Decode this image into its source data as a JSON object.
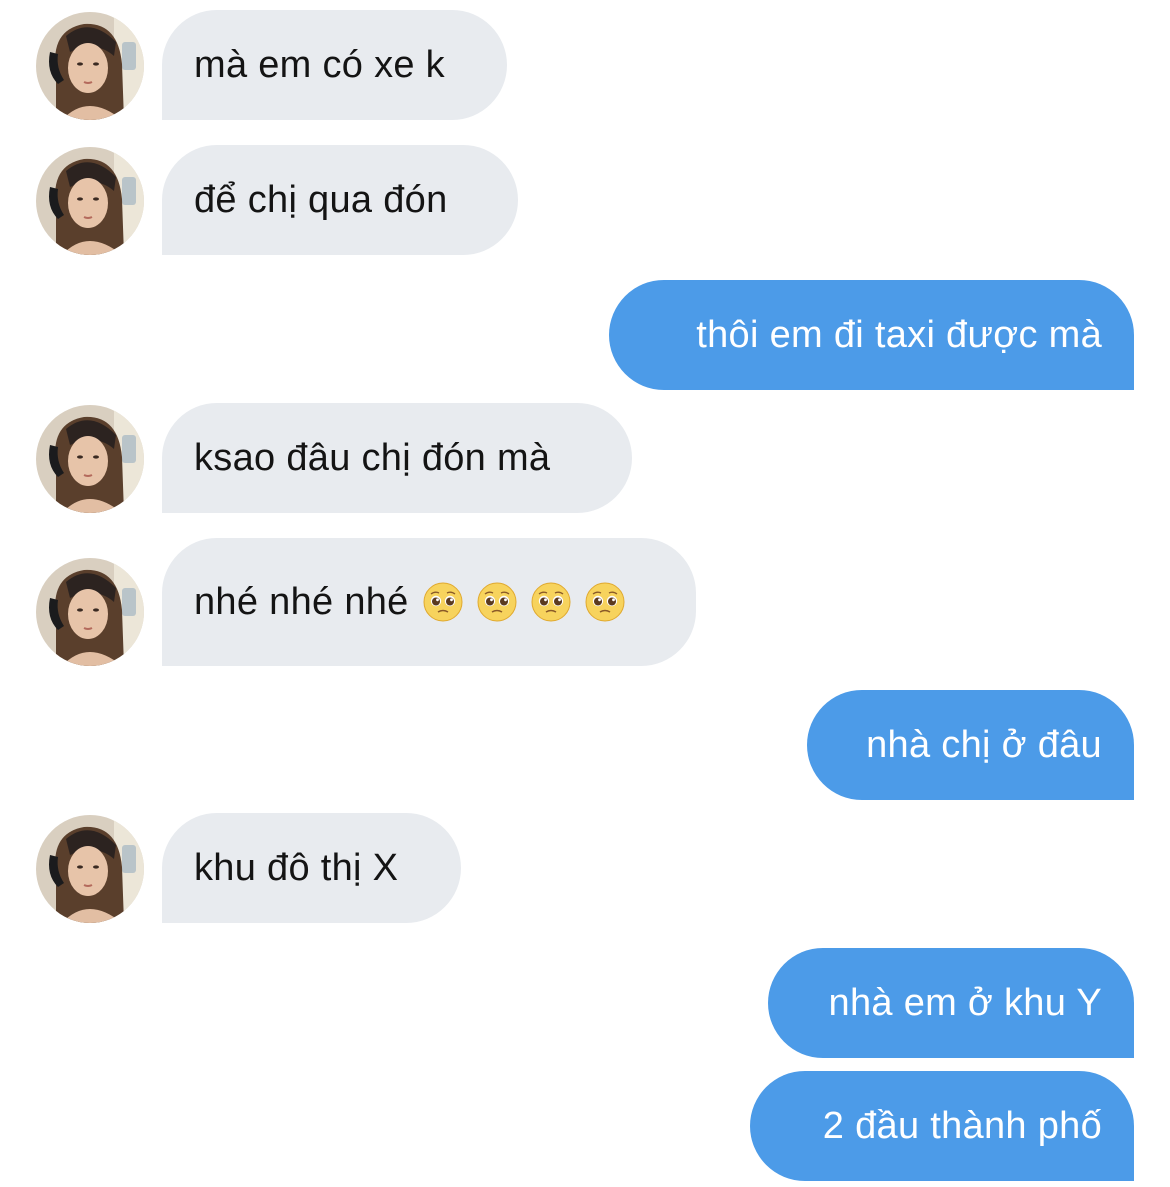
{
  "conversation": {
    "messages": [
      {
        "direction": "incoming",
        "text": "mà em có xe k",
        "avatar": "contact-avatar"
      },
      {
        "direction": "incoming",
        "text": "để chị qua đón",
        "avatar": "contact-avatar"
      },
      {
        "direction": "outgoing",
        "text": "thôi em đi taxi được mà"
      },
      {
        "direction": "incoming",
        "text": "ksao đâu chị đón mà",
        "avatar": "contact-avatar"
      },
      {
        "direction": "incoming",
        "text": "nhé nhé nhé",
        "emoji": [
          "pleading-face",
          "pleading-face",
          "pleading-face",
          "pleading-face"
        ],
        "avatar": "contact-avatar"
      },
      {
        "direction": "outgoing",
        "text": "nhà chị ở đâu"
      },
      {
        "direction": "incoming",
        "text": "khu đô thị X",
        "avatar": "contact-avatar"
      },
      {
        "direction": "outgoing",
        "text": "nhà em ở khu Y"
      },
      {
        "direction": "outgoing",
        "text": "2 đầu thành phố"
      }
    ]
  },
  "colors": {
    "incoming_bubble": "#e8ebef",
    "outgoing_bubble": "#4c9be8",
    "incoming_text": "#141414",
    "outgoing_text": "#ffffff"
  }
}
